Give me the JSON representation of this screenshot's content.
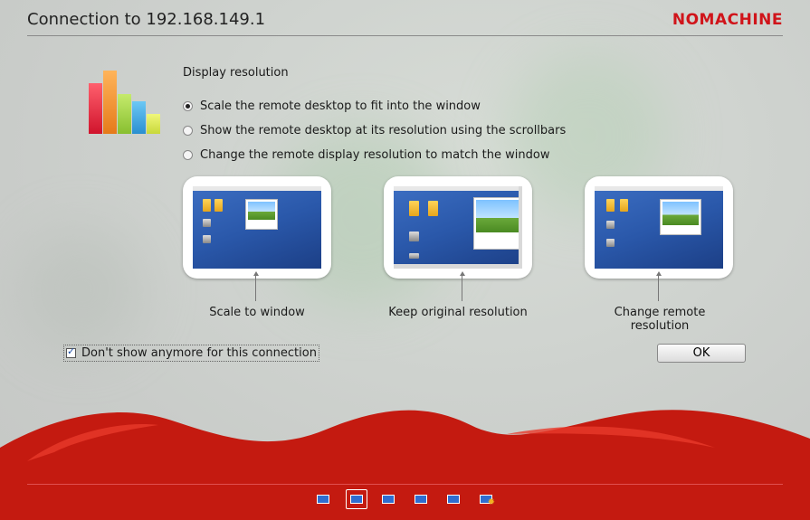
{
  "header": {
    "title": "Connection to 192.168.149.1",
    "brand": "NOMACHINE"
  },
  "main": {
    "section_title": "Display resolution",
    "options": [
      {
        "label": "Scale the remote desktop to fit into the window",
        "checked": true
      },
      {
        "label": "Show the remote desktop at its resolution using the scrollbars",
        "checked": false
      },
      {
        "label": "Change the remote display resolution to match the window",
        "checked": false
      }
    ],
    "previews": [
      {
        "caption": "Scale to window"
      },
      {
        "caption": "Keep original resolution"
      },
      {
        "caption": "Change remote resolution"
      }
    ],
    "dont_show_label": "Don't show anymore for this connection",
    "dont_show_checked": true,
    "ok_label": "OK"
  },
  "toolbar": {
    "icons": [
      "display-icon",
      "scale-icon",
      "resolution-icon",
      "fullscreen-icon",
      "shrink-icon",
      "settings-icon"
    ]
  },
  "colors": {
    "brand_red": "#d0141a",
    "wave_red": "#c41a10",
    "bar_colors": [
      "#e8253a",
      "#f28a2e",
      "#a5d04a",
      "#3aa6e0",
      "#d7e84a"
    ]
  }
}
